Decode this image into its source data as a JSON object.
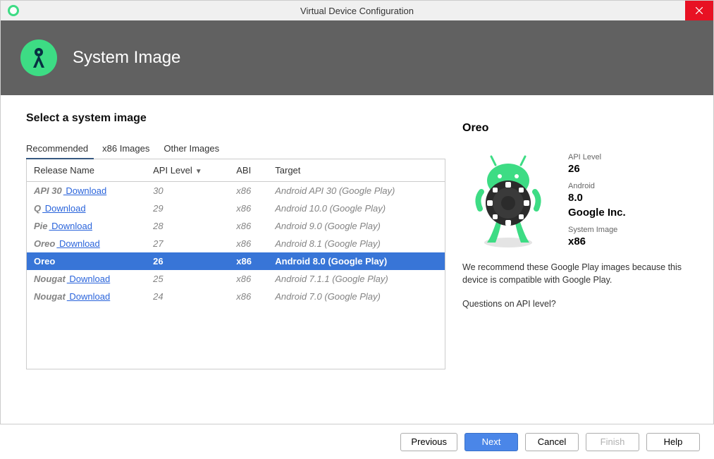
{
  "window": {
    "title": "Virtual Device Configuration"
  },
  "header": {
    "title": "System Image"
  },
  "subtitle": "Select a system image",
  "tabs": [
    {
      "label": "Recommended",
      "active": true
    },
    {
      "label": "x86 Images",
      "active": false
    },
    {
      "label": "Other Images",
      "active": false
    }
  ],
  "columns": {
    "release": "Release Name",
    "api": "API Level",
    "abi": "ABI",
    "target": "Target",
    "sort_indicator": "▼"
  },
  "download_label": "Download",
  "rows": [
    {
      "release": "API 30",
      "needs_download": true,
      "api": "30",
      "abi": "x86",
      "target": "Android API 30 (Google Play)",
      "selected": false
    },
    {
      "release": "Q",
      "needs_download": true,
      "api": "29",
      "abi": "x86",
      "target": "Android 10.0 (Google Play)",
      "selected": false
    },
    {
      "release": "Pie",
      "needs_download": true,
      "api": "28",
      "abi": "x86",
      "target": "Android 9.0 (Google Play)",
      "selected": false
    },
    {
      "release": "Oreo",
      "needs_download": true,
      "api": "27",
      "abi": "x86",
      "target": "Android 8.1 (Google Play)",
      "selected": false
    },
    {
      "release": "Oreo",
      "needs_download": false,
      "api": "26",
      "abi": "x86",
      "target": "Android 8.0 (Google Play)",
      "selected": true
    },
    {
      "release": "Nougat",
      "needs_download": true,
      "api": "25",
      "abi": "x86",
      "target": "Android 7.1.1 (Google Play)",
      "selected": false
    },
    {
      "release": "Nougat",
      "needs_download": true,
      "api": "24",
      "abi": "x86",
      "target": "Android 7.0 (Google Play)",
      "selected": false
    }
  ],
  "detail": {
    "title": "Oreo",
    "api_label": "API Level",
    "api_value": "26",
    "android_label": "Android",
    "android_value": "8.0",
    "vendor": "Google Inc.",
    "sysimg_label": "System Image",
    "sysimg_value": "x86",
    "note": "We recommend these Google Play images because this device is compatible with Google Play.",
    "question": "Questions on API level?"
  },
  "footer": {
    "previous": "Previous",
    "next": "Next",
    "cancel": "Cancel",
    "finish": "Finish",
    "help": "Help"
  }
}
